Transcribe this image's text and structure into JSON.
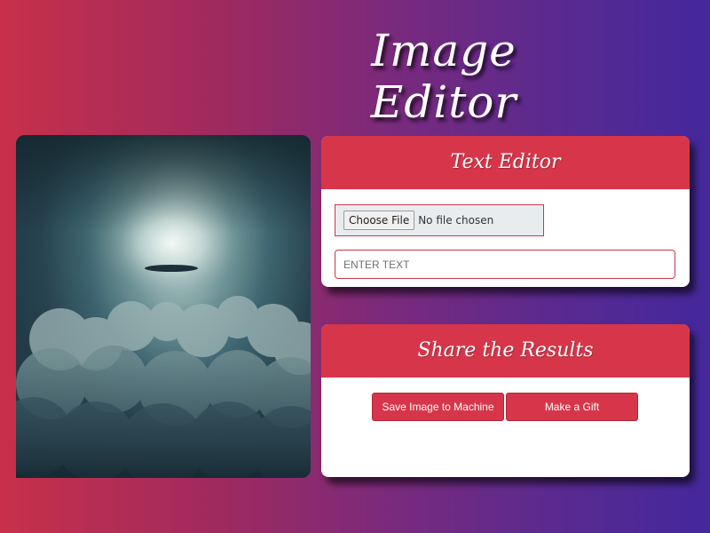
{
  "page": {
    "title": "Image Editor"
  },
  "text_editor": {
    "header": "Text Editor",
    "file_button_label": "Choose File",
    "file_status": "No file chosen",
    "text_placeholder": "ENTER TEXT"
  },
  "share": {
    "header": "Share the Results",
    "save_label": "Save Image to Machine",
    "gift_label": "Make a Gift"
  },
  "colors": {
    "accent": "#d7364a",
    "background_start": "#c8304a",
    "background_end": "#44289c"
  }
}
